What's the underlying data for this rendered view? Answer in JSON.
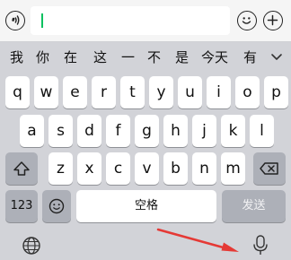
{
  "input_bar": {
    "text_value": ""
  },
  "candidates": [
    "我",
    "你",
    "在",
    "这",
    "一",
    "不",
    "是",
    "今天",
    "有"
  ],
  "keyboard": {
    "row1": [
      "q",
      "w",
      "e",
      "r",
      "t",
      "y",
      "u",
      "i",
      "o",
      "p"
    ],
    "row2": [
      "a",
      "s",
      "d",
      "f",
      "g",
      "h",
      "j",
      "k",
      "l"
    ],
    "row3": [
      "z",
      "x",
      "c",
      "v",
      "b",
      "n",
      "m"
    ],
    "num_label": "123",
    "space_label": "空格",
    "send_label": "发送"
  },
  "colors": {
    "keyboard_bg": "#d2d3d8",
    "key_bg": "#ffffff",
    "key_dark_bg": "#adb0b8",
    "caret": "#07c160",
    "arrow": "#e53935"
  },
  "icons": {
    "voice_input": "voice-wave-icon",
    "emoji": "emoji-smile-icon",
    "add": "plus-icon",
    "expand": "chevron-down-icon",
    "shift": "shift-arrow-icon",
    "delete": "backspace-icon",
    "globe": "globe-icon",
    "mic": "microphone-icon",
    "annotation": "red-arrow-annotation"
  }
}
